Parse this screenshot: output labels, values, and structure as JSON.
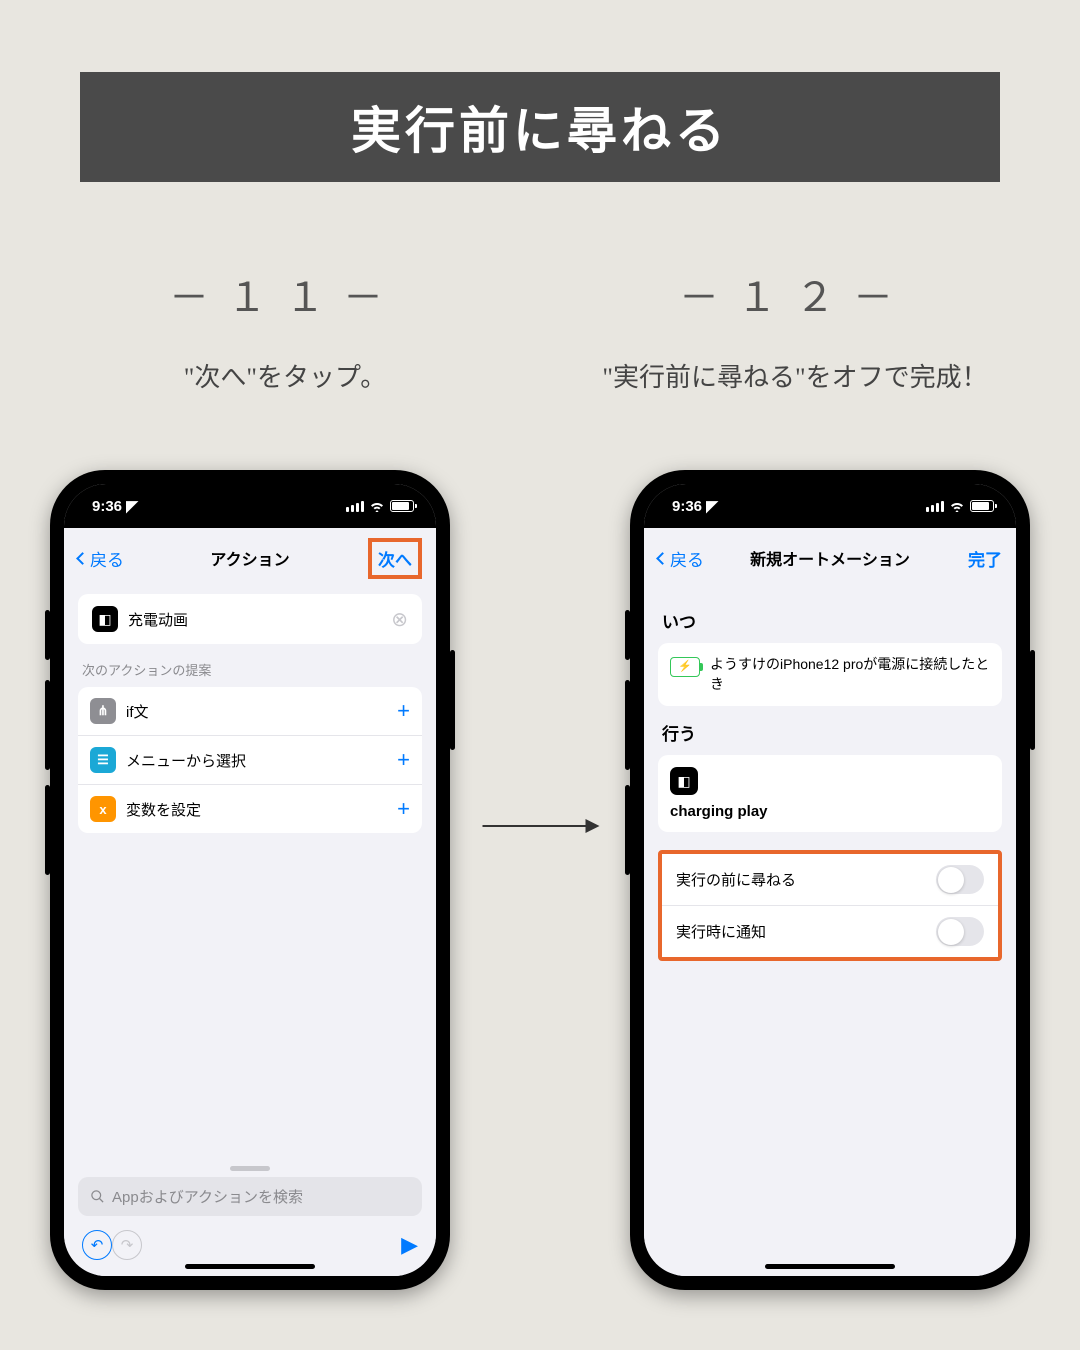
{
  "banner": "実行前に尋ねる",
  "step11": {
    "num": "－１１－",
    "desc": "\"次へ\"をタップ。"
  },
  "step12": {
    "num": "－１２－",
    "desc": "\"実行前に尋ねる\"をオフで完成！"
  },
  "status": {
    "time": "9:36"
  },
  "left": {
    "back": "戻る",
    "title": "アクション",
    "next": "次へ",
    "shortcut": "充電动画",
    "suggest_label": "次のアクションの提案",
    "rows": [
      {
        "label": "if文",
        "icon_bg": "#8e8e93",
        "icon": "⋔"
      },
      {
        "label": "メニューから選択",
        "icon_bg": "#1ba8d6",
        "icon": "☰"
      },
      {
        "label": "変数を設定",
        "icon_bg": "#ff9500",
        "icon": "x"
      }
    ],
    "search_placeholder": "Appおよびアクションを検索"
  },
  "right": {
    "back": "戻る",
    "title": "新規オートメーション",
    "done": "完了",
    "when_label": "いつ",
    "when_text": "ようすけのiPhone12 proが電源に接続したとき",
    "do_label": "行う",
    "action_name": "charging play",
    "toggles": [
      {
        "label": "実行の前に尋ねる"
      },
      {
        "label": "実行時に通知"
      }
    ]
  }
}
